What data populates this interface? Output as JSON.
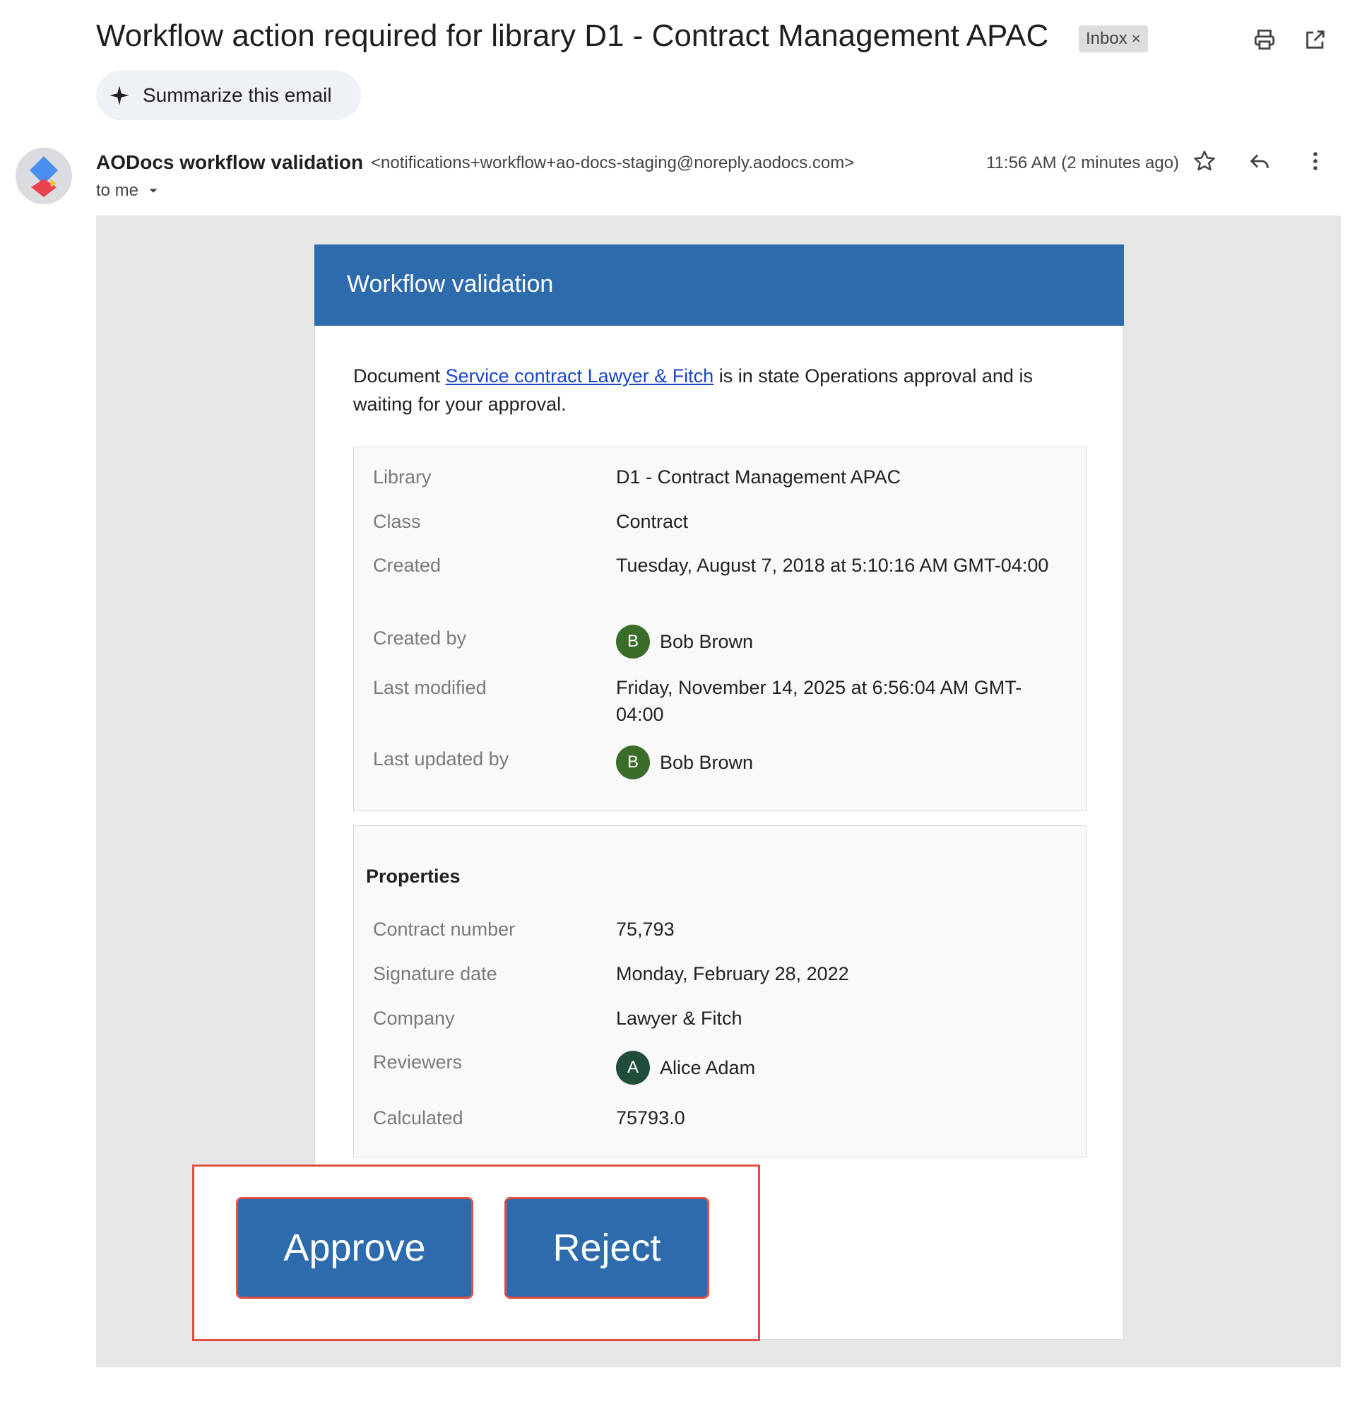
{
  "email": {
    "subject": "Workflow action required for library D1 - Contract Management APAC",
    "label_chip": "Inbox",
    "label_remove": "×",
    "summarize_label": "Summarize this email",
    "sender_name": "AODocs workflow validation",
    "sender_email": "<notifications+workflow+ao-docs-staging@noreply.aodocs.com>",
    "recipient": "to me",
    "timestamp": "11:56 AM (2 minutes ago)"
  },
  "icons": {
    "print": "print-icon",
    "open_new": "open-in-new-window-icon",
    "sparkle": "sparkle-icon",
    "star": "star-icon",
    "reply": "reply-icon",
    "more": "more-vert-icon",
    "dropdown": "caret-down-icon"
  },
  "card": {
    "header": "Workflow validation",
    "intro_prefix": "Document ",
    "doc_link": "Service contract Lawyer & Fitch",
    "intro_suffix": " is in state Operations approval and is waiting for your approval.",
    "details": {
      "library_label": "Library",
      "library_value": "D1 - Contract Management APAC",
      "class_label": "Class",
      "class_value": "Contract",
      "created_label": "Created",
      "created_value": "Tuesday, August 7, 2018 at 5:10:16 AM GMT-04:00",
      "created_by_label": "Created by",
      "created_by_initial": "B",
      "created_by_name": "Bob Brown",
      "last_modified_label": "Last modified",
      "last_modified_value": "Friday, November 14, 2025 at 6:56:04 AM GMT-04:00",
      "last_updated_by_label": "Last updated by",
      "last_updated_by_initial": "B",
      "last_updated_by_name": "Bob Brown"
    },
    "properties": {
      "title": "Properties",
      "contract_number_label": "Contract number",
      "contract_number_value": "75,793",
      "signature_date_label": "Signature date",
      "signature_date_value": "Monday, February 28, 2022",
      "company_label": "Company",
      "company_value": "Lawyer & Fitch",
      "reviewers_label": "Reviewers",
      "reviewer_initial": "A",
      "reviewer_name": "Alice Adam",
      "calculated_label": "Calculated",
      "calculated_value": "75793.0"
    },
    "approve_label": "Approve",
    "reject_label": "Reject"
  },
  "colors": {
    "header_blue": "#2d6bad",
    "link_blue": "#1a46c9",
    "highlight_red": "#e14f44",
    "avatar_green_b": "#3b6d2a",
    "avatar_green_a": "#1f4d3a"
  }
}
